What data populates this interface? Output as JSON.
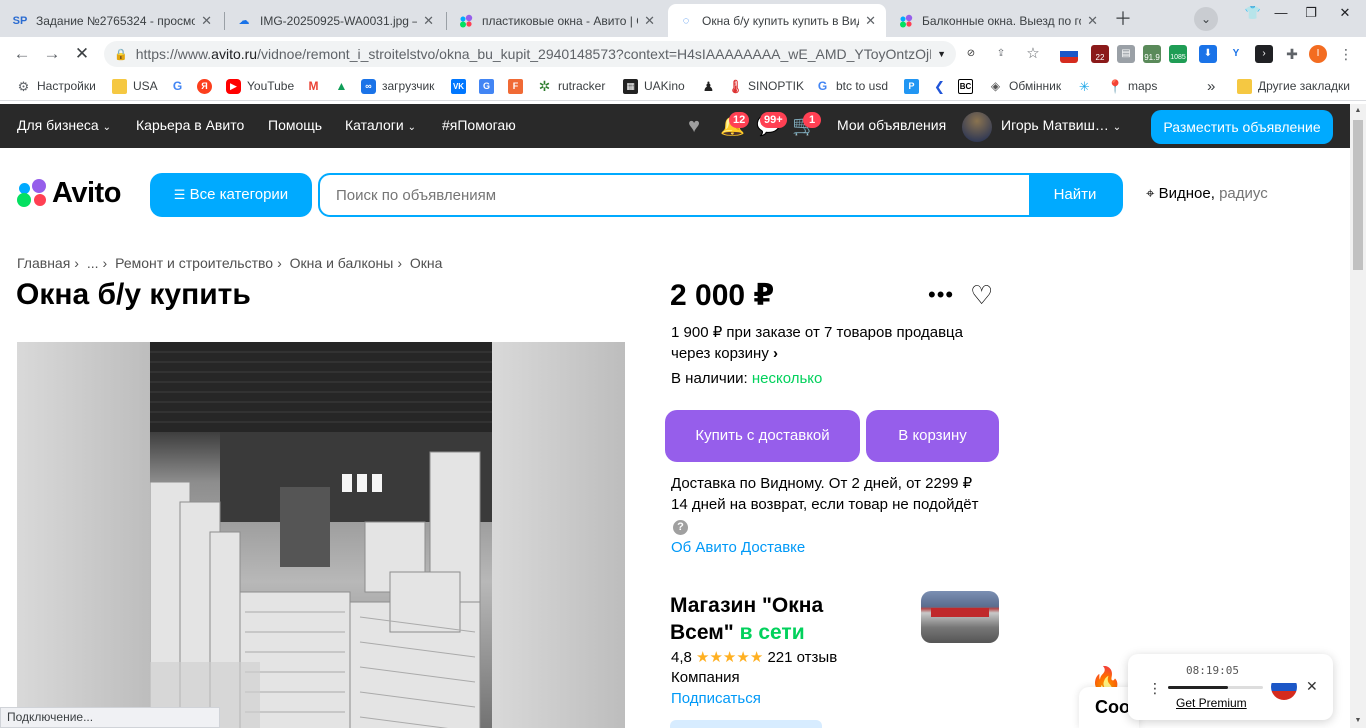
{
  "browser": {
    "tabs": [
      {
        "title": "Задание №2765324 - просмо",
        "icon": "sp-favicon",
        "icon_text": "SP"
      },
      {
        "title": "IMG-20250925-WA0031.jpg —",
        "icon": "cloud-favicon"
      },
      {
        "title": "пластиковые окна - Авито | О",
        "icon": "avito-favicon"
      },
      {
        "title": "Окна б/у купить купить в Вид",
        "icon": "loading-icon",
        "active": true
      },
      {
        "title": "Балконные окна. Выезд по го",
        "icon": "avito-favicon"
      }
    ],
    "url_prefix": "https://www.",
    "url_host": "avito.ru",
    "url_rest": "/vidnoe/remont_i_stroitelstvo/okna_bu_kupit_2940148573?context=H4sIAAAAAAAA_wE_AMD_YToyOntzOjEz...",
    "extension_badges": {
      "ext1": "22",
      "ext2": "91.9",
      "ext3": "1085"
    },
    "bookmarks": [
      {
        "label": "Настройки",
        "icon": "gear-icon"
      },
      {
        "label": "USA",
        "icon": "folder-icon"
      },
      {
        "label": "",
        "icon": "google-icon"
      },
      {
        "label": "",
        "icon": "yandex-icon"
      },
      {
        "label": "YouTube",
        "icon": "youtube-icon"
      },
      {
        "label": "",
        "icon": "gmail-icon"
      },
      {
        "label": "",
        "icon": "drive-icon"
      },
      {
        "label": "загрузчик",
        "icon": "infinity-icon"
      },
      {
        "label": "",
        "icon": "vk-icon"
      },
      {
        "label": "",
        "icon": "translate-icon"
      },
      {
        "label": "",
        "icon": "f-icon"
      },
      {
        "label": "rutracker",
        "icon": "rutracker-icon"
      },
      {
        "label": "UAKino",
        "icon": "uakino-icon"
      },
      {
        "label": "",
        "icon": "chess-icon"
      },
      {
        "label": "SINOPTIK",
        "icon": "thermometer-icon"
      },
      {
        "label": "btc to usd",
        "icon": "google-icon"
      },
      {
        "label": "",
        "icon": "p-icon"
      },
      {
        "label": "",
        "icon": "arrow-icon"
      },
      {
        "label": "",
        "icon": "bc-icon"
      },
      {
        "label": "Обмінник",
        "icon": "exchange-icon"
      },
      {
        "label": "",
        "icon": "snowflake-icon"
      },
      {
        "label": "maps",
        "icon": "maps-icon"
      }
    ],
    "bookmarks_more": "»",
    "other_bookmarks": "Другие закладки",
    "status_text": "Подключение..."
  },
  "avito": {
    "topnav": {
      "business": "Для бизнеса",
      "career": "Карьера в Авито",
      "help": "Помощь",
      "catalogs": "Каталоги",
      "ihelp": "#яПомогаю",
      "badge_notifications": "12",
      "badge_messages": "99+",
      "badge_cart": "1",
      "my_ads": "Мои объявления",
      "user_name": "Игорь Матвиш…",
      "post_ad": "Разместить объявление"
    },
    "logo": "Avito",
    "all_categories": "Все категории",
    "search_placeholder": "Поиск по объявлениям",
    "search_button": "Найти",
    "location": "Видное,",
    "radius": "радиус",
    "breadcrumbs": [
      "Главная",
      "...",
      "Ремонт и строительство",
      "Окна и балконы",
      "Окна"
    ],
    "item": {
      "title": "Окна б/у купить",
      "price": "2 000 ₽",
      "bulk_line1": "1 900 ₽ при заказе от 7 товаров продавца",
      "bulk_line2": "через корзину",
      "availability_label": "В наличии:",
      "availability_value": "несколько",
      "buy_button": "Купить с доставкой",
      "cart_button": "В корзину",
      "delivery": "Доставка по Видному. От 2 дней, от 2299 ₽",
      "return_policy": "14 дней на возврат, если товар не подойдёт",
      "delivery_link": "Об Авито Доставке"
    },
    "seller": {
      "name_line1": "Магазин \"Окна",
      "name_line2": "Всем\"",
      "online": "в сети",
      "rating": "4,8",
      "stars": "★★★★★",
      "reviews": "221 отзыв",
      "type": "Компания",
      "subscribe": "Подписаться"
    },
    "cookie_peek": "Coo"
  },
  "vpn_widget": {
    "time": "08:19:05",
    "premium": "Get Premium",
    "progress": 0.63,
    "country": "Russia"
  },
  "colors": {
    "avito_blue": "#00aaff",
    "avito_purple": "#965eeb",
    "avito_green": "#02d15c",
    "topbar": "#292929",
    "badge_red": "#ff4053"
  }
}
